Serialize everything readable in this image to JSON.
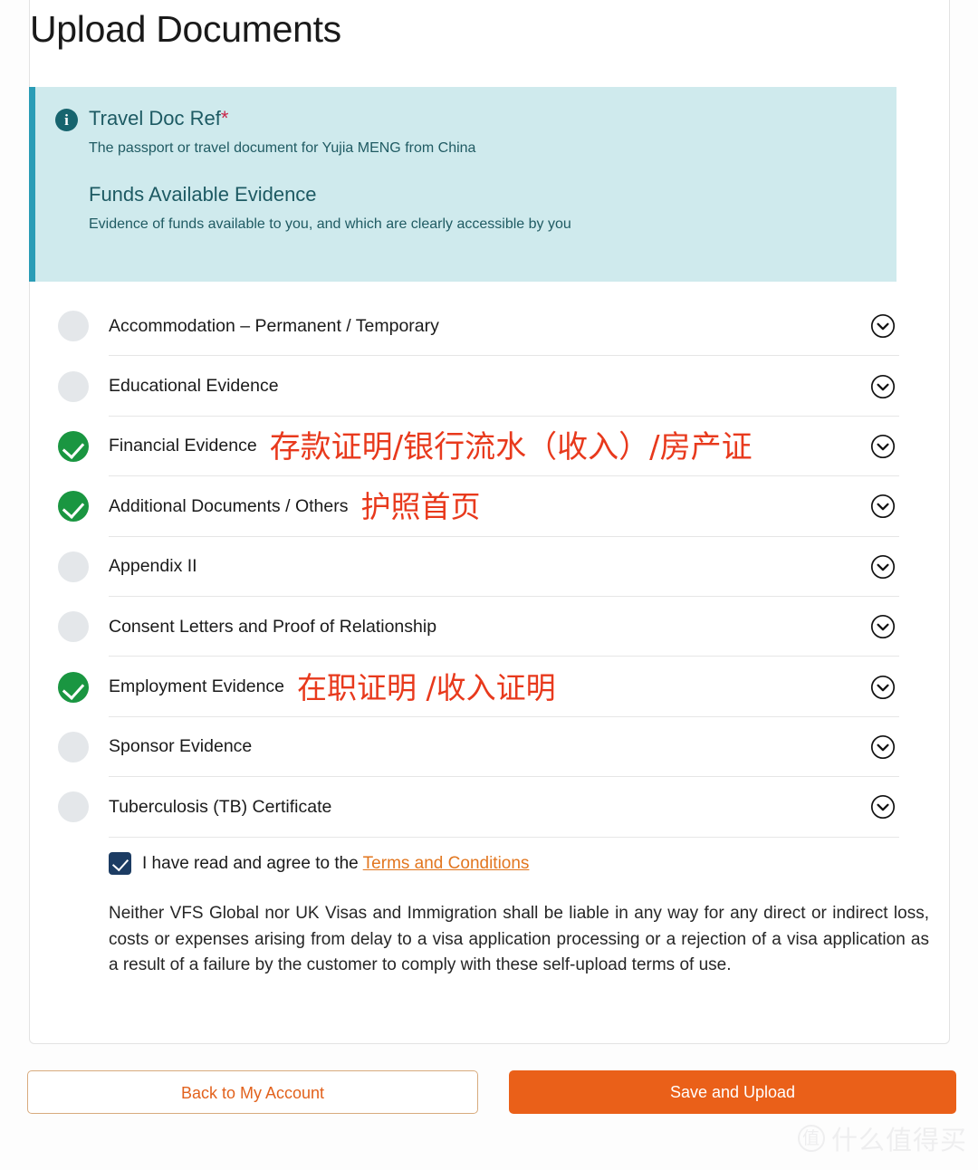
{
  "page": {
    "title": "Upload Documents"
  },
  "banner": {
    "info_icon": "info-icon",
    "doc_ref_title": "Travel Doc Ref",
    "required_marker": "*",
    "doc_ref_desc": "The passport or travel document for Yujia MENG from China",
    "funds_title": "Funds Available Evidence",
    "funds_desc": "Evidence of funds available to you, and which are clearly accessible by you",
    "accent_color": "#2a9cb6",
    "background_color": "#cfeaed",
    "text_color": "#1d5a63"
  },
  "documents": [
    {
      "label": "Accommodation – Permanent / Temporary",
      "status": "pending",
      "annotation": ""
    },
    {
      "label": "Educational Evidence",
      "status": "pending",
      "annotation": ""
    },
    {
      "label": "Financial Evidence",
      "status": "complete",
      "annotation": "存款证明/银行流水（收入）/房产证"
    },
    {
      "label": "Additional Documents / Others",
      "status": "complete",
      "annotation": "护照首页"
    },
    {
      "label": "Appendix II",
      "status": "pending",
      "annotation": ""
    },
    {
      "label": "Consent Letters and Proof of Relationship",
      "status": "pending",
      "annotation": ""
    },
    {
      "label": "Employment Evidence",
      "status": "complete",
      "annotation": "在职证明 /收入证明"
    },
    {
      "label": "Sponsor Evidence",
      "status": "pending",
      "annotation": ""
    },
    {
      "label": "Tuberculosis (TB) Certificate",
      "status": "pending",
      "annotation": ""
    }
  ],
  "agreement": {
    "checked": true,
    "text_before_link": "I have read and agree to the ",
    "link_label": "Terms and Conditions",
    "disclaimer": "Neither VFS Global nor UK Visas and Immigration shall be liable in any way for any direct or indirect loss, costs or expenses arising from delay to a visa application processing or a rejection of a visa application as a result of a failure by the customer to comply with these self-upload terms of use.",
    "link_color": "#e2761f",
    "checkbox_color": "#1c3c63"
  },
  "footer": {
    "back_label": "Back to My Account",
    "save_label": "Save and Upload",
    "primary_color": "#ea6019",
    "secondary_text_color": "#e2621d"
  },
  "watermark": {
    "badge": "值",
    "text": "什么值得买"
  },
  "icons": {
    "chevron": "chevron-down-icon",
    "check": "check-icon"
  },
  "colors": {
    "status_complete": "#1a9641",
    "status_pending": "#e4e7ea",
    "annotation_red": "#e8391c"
  }
}
